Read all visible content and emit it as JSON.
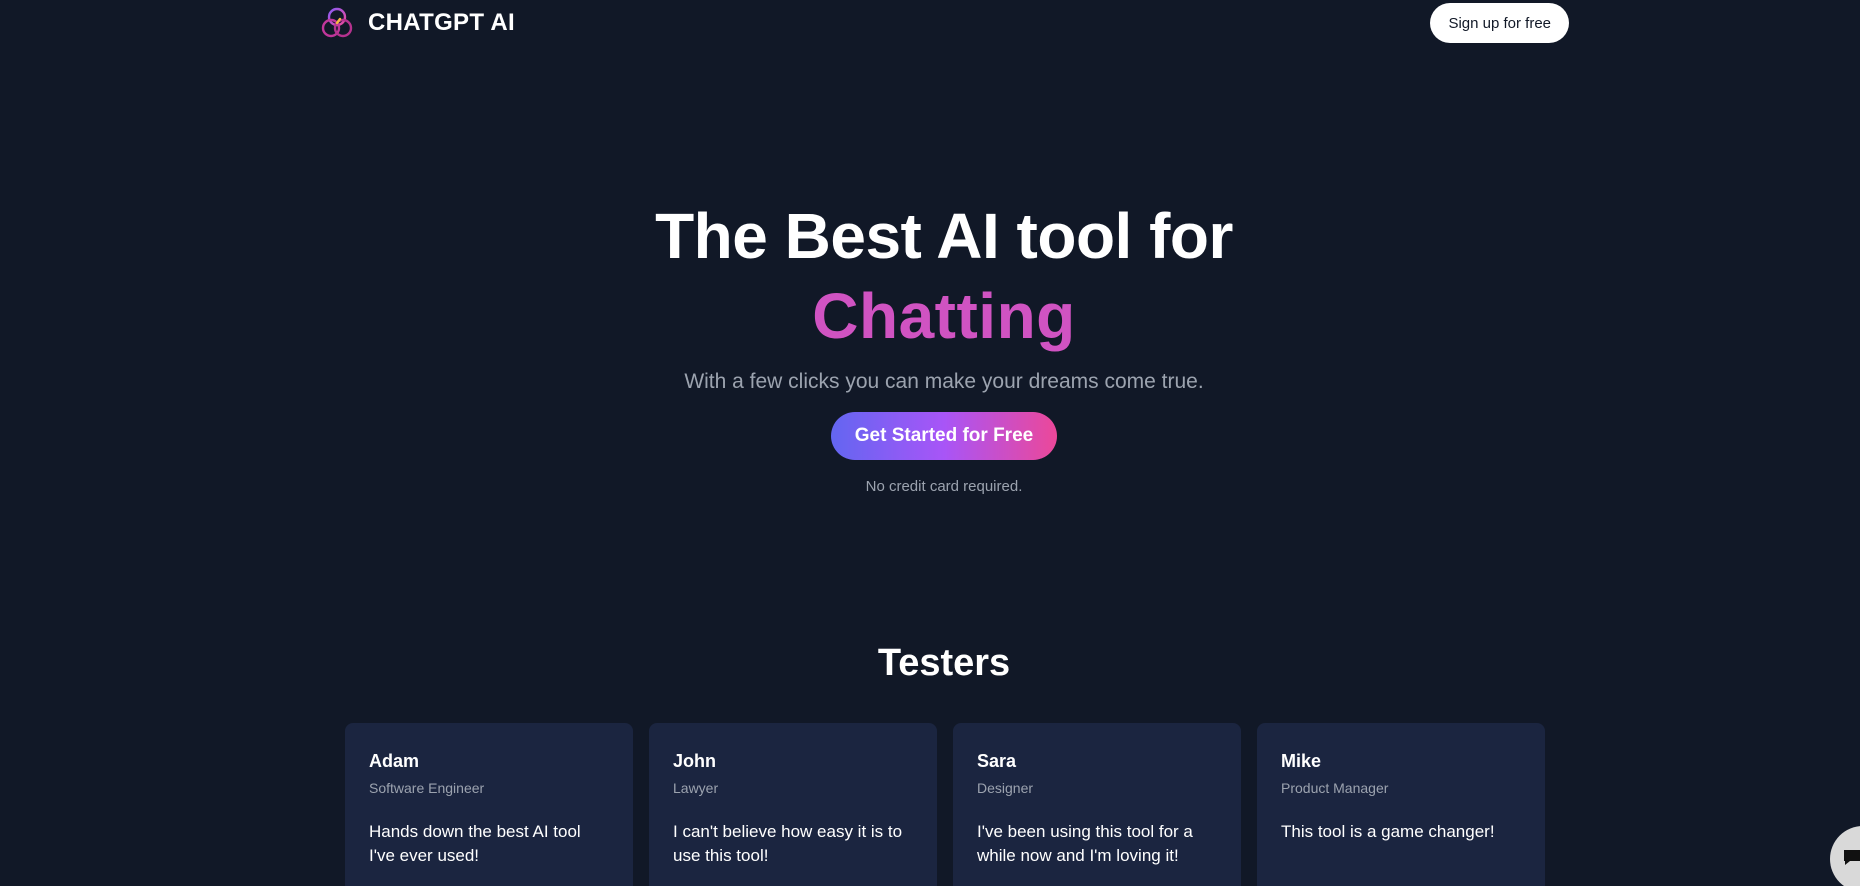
{
  "header": {
    "brand_name": "CHATGPT AI",
    "logo_icon": "three-rings-logo-icon",
    "signup_label": "Sign up for free"
  },
  "hero": {
    "title": "The Best AI tool for",
    "accent": "Chatting",
    "subtitle": "With a few clicks you can make your dreams come true.",
    "cta_label": "Get Started for Free",
    "note": "No credit card required."
  },
  "testers": {
    "title": "Testers",
    "cards": [
      {
        "name": "Adam",
        "role": "Software Engineer",
        "quote": "Hands down the best AI tool I've ever used!"
      },
      {
        "name": "John",
        "role": "Lawyer",
        "quote": "I can't believe how easy it is to use this tool!"
      },
      {
        "name": "Sara",
        "role": "Designer",
        "quote": "I've been using this tool for a while now and I'm loving it!"
      },
      {
        "name": "Mike",
        "role": "Product Manager",
        "quote": "This tool is a game changer!"
      }
    ]
  },
  "chat_widget": {
    "icon": "chat-bubble-icon"
  },
  "colors": {
    "background": "#111827",
    "card_background": "#1b2540",
    "accent_pink": "#d053c2",
    "cta_gradient_start": "#6366f1",
    "cta_gradient_end": "#ec4899",
    "muted_text": "#9ca3af"
  }
}
